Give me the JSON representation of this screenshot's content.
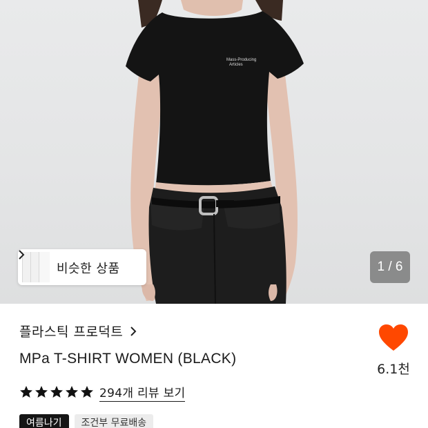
{
  "image": {
    "print_line1": "Mass-Producing",
    "print_line2": "Articles"
  },
  "similar": {
    "label": "비슷한 상품"
  },
  "gallery": {
    "counter": "1 / 6"
  },
  "product": {
    "brand": "플라스틱 프로덕트",
    "title": "MPa T-SHIRT WOMEN (BLACK)"
  },
  "like": {
    "count": "6.1천",
    "color": "#ff4800"
  },
  "rating": {
    "stars": 5,
    "review_link": "294개 리뷰 보기"
  },
  "tags": [
    {
      "label": "여름나기"
    },
    {
      "label": "조건부 무료배송"
    }
  ]
}
